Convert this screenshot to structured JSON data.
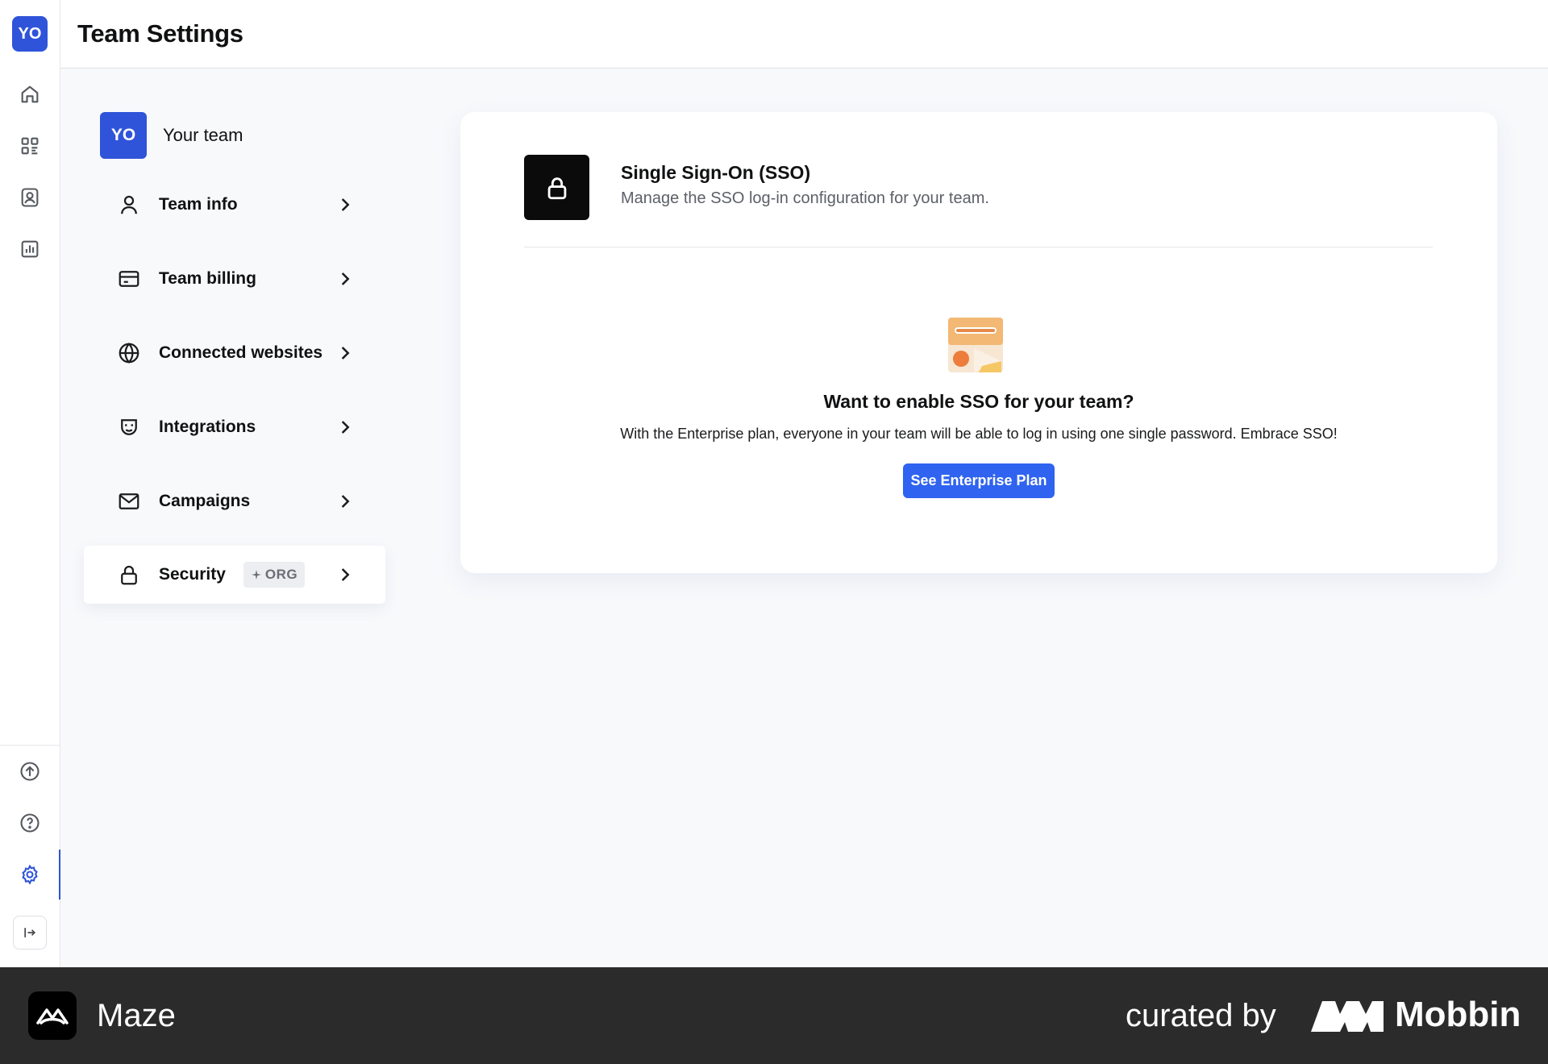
{
  "rail": {
    "avatar_initials": "YO",
    "items": [
      "home-icon",
      "dashboard-icon",
      "contacts-icon",
      "analytics-icon"
    ],
    "bottom_items": [
      "upgrade-icon",
      "help-icon",
      "settings-icon",
      "collapse-icon"
    ]
  },
  "header": {
    "title": "Team Settings"
  },
  "team": {
    "avatar_initials": "YO",
    "name": "Your team",
    "nav": [
      {
        "label": "Team info",
        "icon": "user-icon"
      },
      {
        "label": "Team billing",
        "icon": "credit-card-icon"
      },
      {
        "label": "Connected websites",
        "icon": "globe-icon"
      },
      {
        "label": "Integrations",
        "icon": "plug-icon"
      },
      {
        "label": "Campaigns",
        "icon": "mail-icon"
      },
      {
        "label": "Security",
        "icon": "lock-icon",
        "badge": "ORG",
        "active": true
      }
    ]
  },
  "sso": {
    "title": "Single Sign-On (SSO)",
    "subtitle": "Manage the SSO log-in configuration for your team.",
    "cta_title": "Want to enable SSO for your team?",
    "cta_text": "With the Enterprise plan, everyone in your team will be able to log in using one single password. Embrace SSO!",
    "cta_button": "See Enterprise Plan"
  },
  "footer": {
    "app_name": "Maze",
    "curated_by": "curated by",
    "brand": "Mobbin"
  },
  "colors": {
    "accent": "#2f54d9",
    "button": "#2f63f0",
    "footer_bg": "#2b2b2b"
  }
}
